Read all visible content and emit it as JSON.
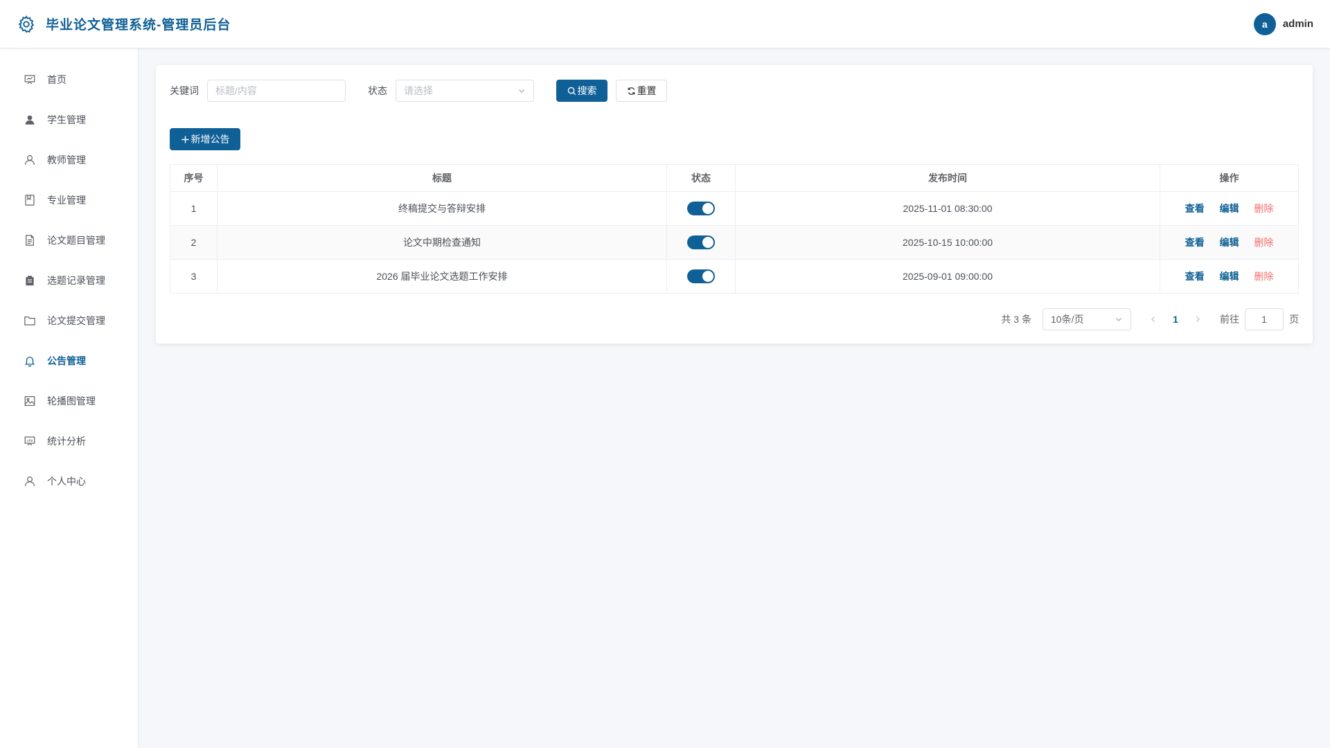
{
  "header": {
    "title": "毕业论文管理系统-管理员后台",
    "avatar_letter": "a",
    "username": "admin"
  },
  "sidebar": {
    "items": [
      {
        "label": "首页",
        "icon": "presentation-board-icon"
      },
      {
        "label": "学生管理",
        "icon": "user-filled-icon"
      },
      {
        "label": "教师管理",
        "icon": "user-icon"
      },
      {
        "label": "专业管理",
        "icon": "notebook-icon"
      },
      {
        "label": "论文题目管理",
        "icon": "document-icon"
      },
      {
        "label": "选题记录管理",
        "icon": "clipboard-icon"
      },
      {
        "label": "论文提交管理",
        "icon": "folder-icon"
      },
      {
        "label": "公告管理",
        "icon": "bell-icon",
        "active": true
      },
      {
        "label": "轮播图管理",
        "icon": "picture-icon"
      },
      {
        "label": "统计分析",
        "icon": "data-board-icon"
      },
      {
        "label": "个人中心",
        "icon": "user-icon"
      }
    ]
  },
  "filter": {
    "keyword_label": "关键词",
    "keyword_placeholder": "标题/内容",
    "keyword_value": "",
    "status_label": "状态",
    "status_placeholder": "请选择",
    "search_label": "搜索",
    "reset_label": "重置"
  },
  "toolbar": {
    "add_label": "新增公告"
  },
  "table": {
    "columns": [
      "序号",
      "标题",
      "状态",
      "发布时间",
      "操作"
    ],
    "rows": [
      {
        "index": "1",
        "title": "终稿提交与答辩安排",
        "status_on": true,
        "time": "2025-11-01 08:30:00"
      },
      {
        "index": "2",
        "title": "论文中期检查通知",
        "status_on": true,
        "time": "2025-10-15 10:00:00"
      },
      {
        "index": "3",
        "title": "2026 届毕业论文选题工作安排",
        "status_on": true,
        "time": "2025-09-01 09:00:00"
      }
    ],
    "actions": {
      "view": "查看",
      "edit": "编辑",
      "delete": "删除"
    }
  },
  "pagination": {
    "total_text": "共 3 条",
    "page_size": "10条/页",
    "current_page": "1",
    "goto_label": "前往",
    "goto_value": "1",
    "page_suffix": "页"
  },
  "colors": {
    "primary": "#0f6096",
    "danger": "#f56c6c"
  }
}
